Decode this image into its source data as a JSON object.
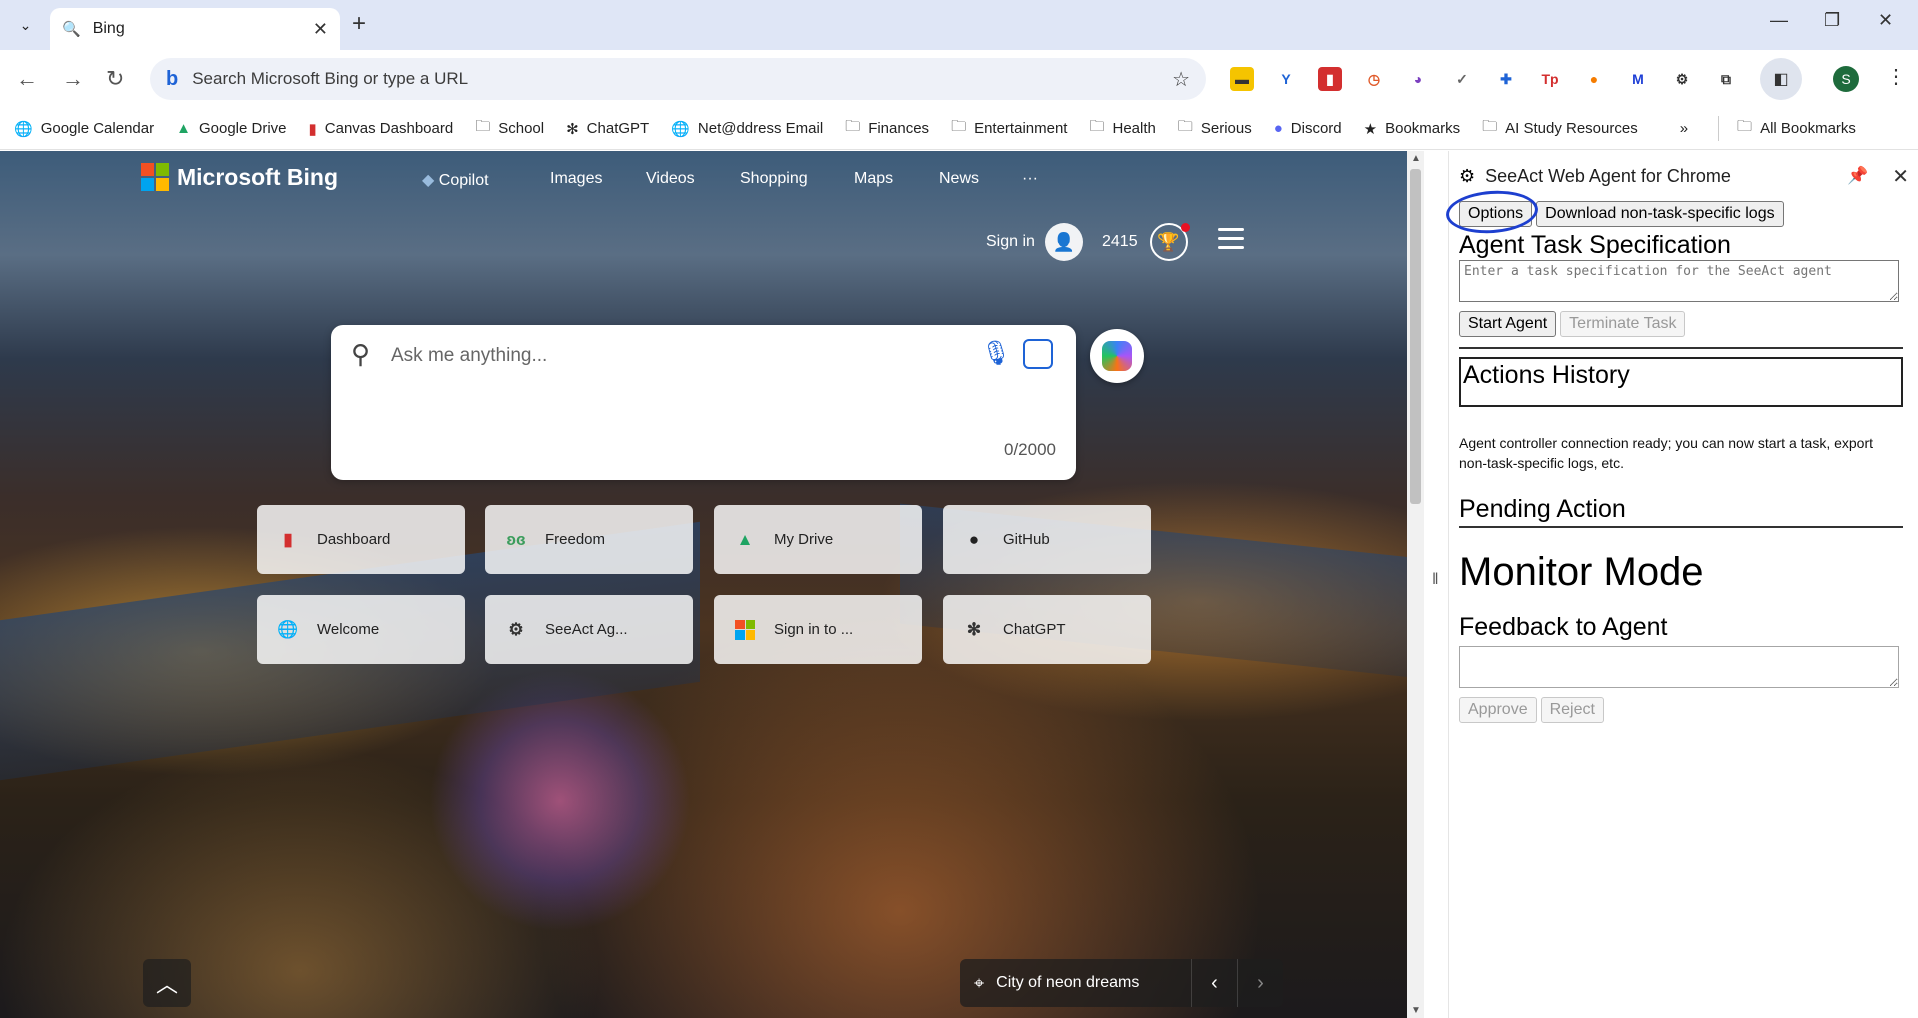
{
  "browser": {
    "tab_title": "Bing",
    "new_tab": "+",
    "omnibox_text": "Search Microsoft Bing or type a URL",
    "bookmarks": [
      {
        "label": "Google Calendar",
        "icon": "globe-icon"
      },
      {
        "label": "Google Drive",
        "icon": "drive-icon"
      },
      {
        "label": "Canvas Dashboard",
        "icon": "canvas-icon"
      },
      {
        "label": "School",
        "icon": "folder-icon"
      },
      {
        "label": "ChatGPT",
        "icon": "chatgpt-icon"
      },
      {
        "label": "Net@ddress Email",
        "icon": "globe-icon"
      },
      {
        "label": "Finances",
        "icon": "folder-icon"
      },
      {
        "label": "Entertainment",
        "icon": "folder-icon"
      },
      {
        "label": "Health",
        "icon": "folder-icon"
      },
      {
        "label": "Serious",
        "icon": "folder-icon"
      },
      {
        "label": "Discord",
        "icon": "discord-icon"
      },
      {
        "label": "Bookmarks",
        "icon": "star-icon"
      },
      {
        "label": "AI Study Resources",
        "icon": "folder-icon"
      }
    ],
    "all_bookmarks": "All Bookmarks",
    "avatar_letter": "S"
  },
  "bing": {
    "brand": "Microsoft Bing",
    "nav": [
      "Copilot",
      "Images",
      "Videos",
      "Shopping",
      "Maps",
      "News",
      "···"
    ],
    "sign_in": "Sign in",
    "points": "2415",
    "search_placeholder": "Ask me anything...",
    "char_count": "0/2000",
    "tiles": [
      {
        "label": "Dashboard"
      },
      {
        "label": "Freedom"
      },
      {
        "label": "My Drive"
      },
      {
        "label": "GitHub"
      },
      {
        "label": "Welcome"
      },
      {
        "label": "SeeAct Ag..."
      },
      {
        "label": "Sign in to ..."
      },
      {
        "label": "ChatGPT"
      }
    ],
    "caption": "City of neon dreams"
  },
  "panel": {
    "title": "SeeAct Web Agent for Chrome",
    "options_label": "Options",
    "download_label": "Download non-task-specific logs",
    "task_heading": "Agent Task Specification",
    "task_placeholder": "Enter a task specification for the SeeAct agent",
    "start_label": "Start Agent",
    "terminate_label": "Terminate Task",
    "actions_heading": "Actions History",
    "status_text": "Agent controller connection ready; you can now start a task, export non-task-specific logs, etc.",
    "pending_heading": "Pending Action",
    "monitor_heading": "Monitor Mode",
    "feedback_heading": "Feedback to Agent",
    "approve_label": "Approve",
    "reject_label": "Reject"
  },
  "colors": {
    "accent_blue": "#1e63d6",
    "annotation_blue": "#1d3fcf",
    "avatar_green": "#1e6b3c"
  }
}
